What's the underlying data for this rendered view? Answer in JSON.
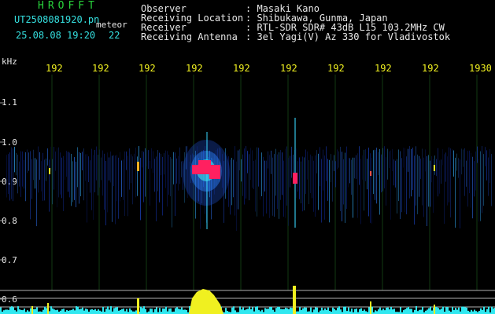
{
  "header": {
    "logo": "HROFFT",
    "filename": "UT2508081920.pn",
    "tag": "meteor",
    "timestamp": "25.08.08 19:20",
    "count": "22"
  },
  "info": [
    {
      "label": "Observer",
      "value": ": Masaki Kano"
    },
    {
      "label": "Receiving Location",
      "value": ": Shibukawa, Gunma, Japan"
    },
    {
      "label": "Receiver",
      "value": ": RTL-SDR SDR# 43dB L15 103.2MHz CW"
    },
    {
      "label": "Receiving Antenna",
      "value": ": 3el Yagi(V) Az 330 for Vladivostok"
    }
  ],
  "axis": {
    "unit": "kHz",
    "time_ticks": [
      "192",
      "192",
      "192",
      "192",
      "192",
      "192",
      "192",
      "192",
      "192",
      "1930"
    ],
    "freq_ticks": [
      "1.1",
      "1.0",
      "0.9",
      "0.8",
      "0.7",
      "0.6"
    ]
  },
  "colors": {
    "background": "#000000",
    "text_green": "#28d23c",
    "text_cyan": "#35e0e0",
    "tick_yellow": "#f0f020",
    "echo_red": "#ff2060",
    "meter_cyan": "#30e8f0"
  }
}
